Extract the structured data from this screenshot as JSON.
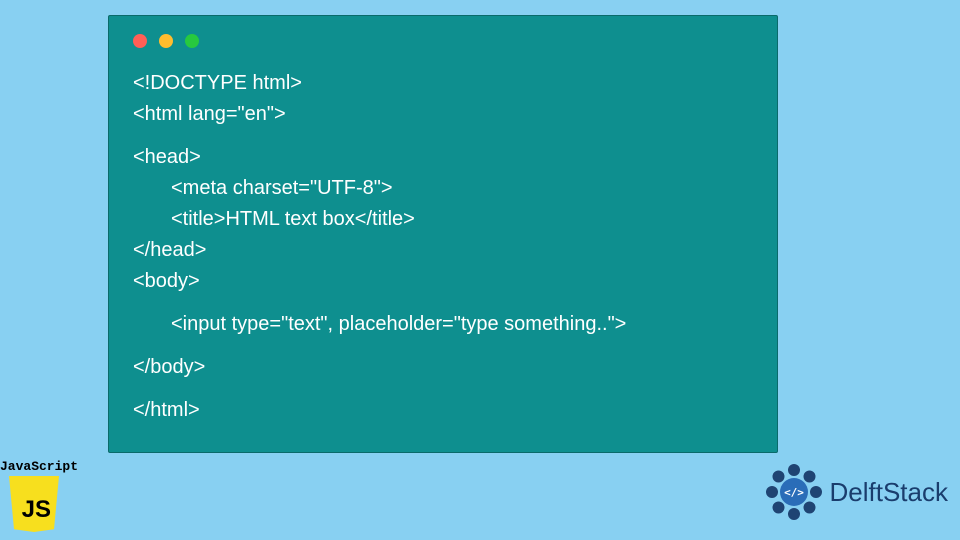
{
  "code": {
    "lines": [
      "<!DOCTYPE html>",
      "<html lang=\"en\">",
      "<head>",
      "<meta charset=\"UTF-8\">",
      "<title>HTML text box</title>",
      "</head>",
      "<body>",
      "<input type=\"text\", placeholder=\"type something..\">",
      "</body>",
      "</html>"
    ]
  },
  "badges": {
    "js_label": "JavaScript",
    "js_logo_text": "JS",
    "delft_text": "DelftStack"
  },
  "colors": {
    "background": "#88d0f2",
    "window": "#0e8f8f",
    "code_text": "#ffffff",
    "dot_red": "#ff5f56",
    "dot_yellow": "#ffbd2e",
    "dot_green": "#27c93f",
    "js_yellow": "#f7df1e",
    "delft_blue": "#1a3d6d"
  }
}
